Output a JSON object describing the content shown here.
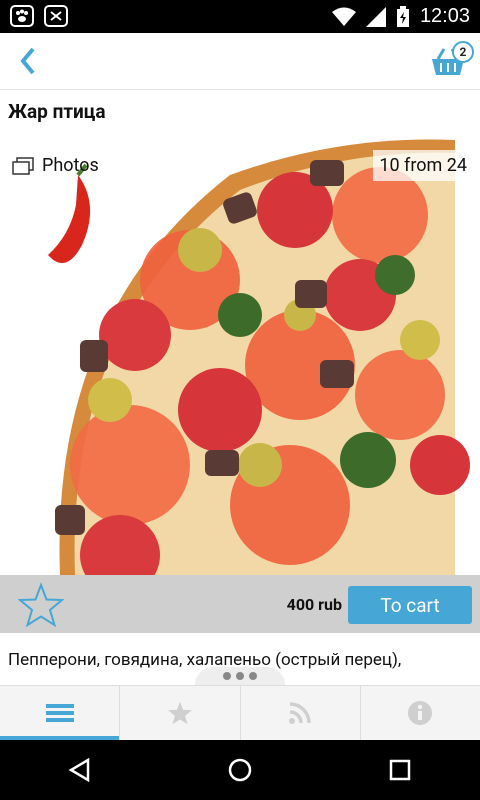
{
  "status_bar": {
    "time": "12:03",
    "icons": [
      "paw-icon",
      "shield-icon",
      "wifi-icon",
      "signal-icon",
      "battery-icon"
    ]
  },
  "app_bar": {
    "cart_count": "2"
  },
  "product": {
    "title": "Жар птица",
    "photos_label": "Photos",
    "photo_counter": "10 from 24",
    "price": "400 rub",
    "to_cart_label": "To cart",
    "description": "Пепперони, говядина, халапеньо (острый перец),"
  },
  "tabs": [
    {
      "name": "menu",
      "icon": "menu-icon",
      "active": true
    },
    {
      "name": "favorites",
      "icon": "star-icon",
      "active": false
    },
    {
      "name": "news",
      "icon": "rss-icon",
      "active": false
    },
    {
      "name": "info",
      "icon": "info-icon",
      "active": false
    }
  ],
  "colors": {
    "accent": "#46a6d6",
    "price_bar": "#cfcfcf",
    "tab_bar": "#f4f4f4"
  }
}
